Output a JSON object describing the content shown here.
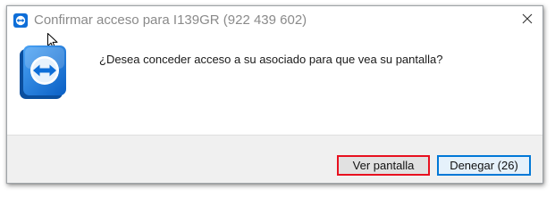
{
  "window": {
    "title": "Confirmar acceso para I139GR (922 439 602)",
    "app_icon": "teamviewer-icon",
    "close_icon": "close-icon"
  },
  "dialog": {
    "message": "¿Desea conceder acceso a su asociado para que vea su pantalla?",
    "icon": "teamviewer-logo-icon"
  },
  "buttons": {
    "view_label": "Ver pantalla",
    "deny_label": "Denegar (26)"
  },
  "colors": {
    "brand_blue": "#0e6ed8",
    "highlight_red": "#e8101f",
    "focus_blue": "#0078d7"
  }
}
